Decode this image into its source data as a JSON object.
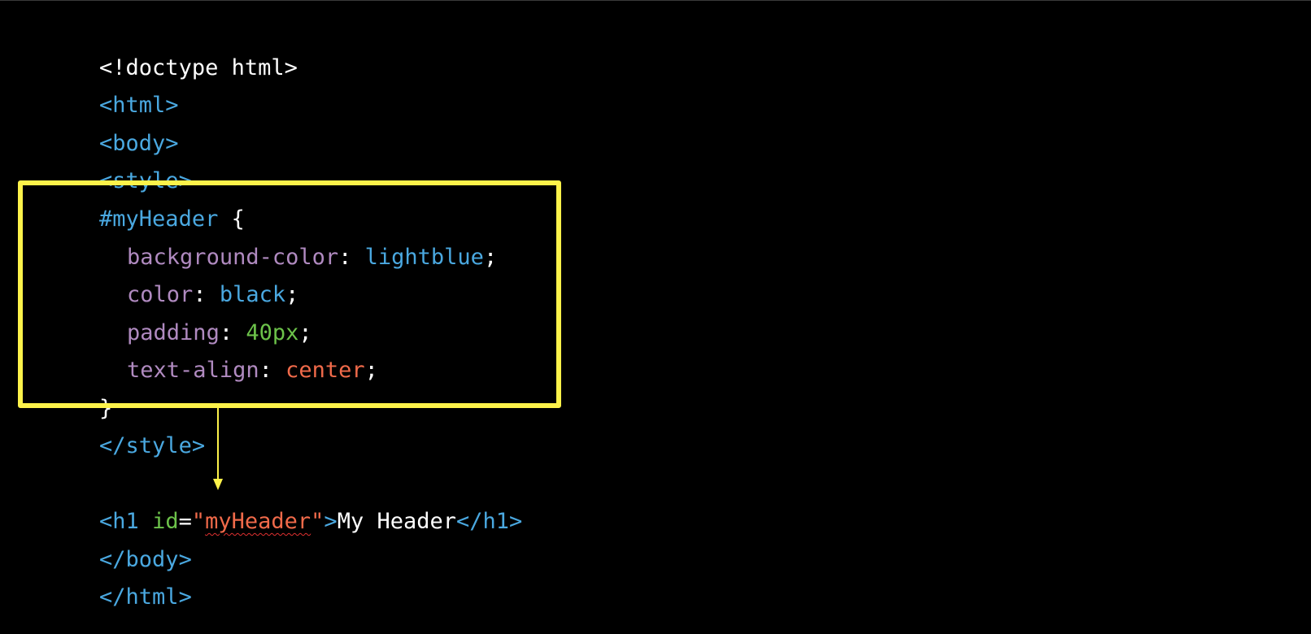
{
  "code": {
    "doctype": "<!doctype html>",
    "html_open": "<html>",
    "body_open": "<body>",
    "style_open": "<style>",
    "selector": "#myHeader",
    "brace_open": " {",
    "rules": [
      {
        "property": "background-color",
        "colon": ": ",
        "value": "lightblue",
        "semicolon": ";"
      },
      {
        "property": "color",
        "colon": ": ",
        "value": "black",
        "semicolon": ";"
      },
      {
        "property": "padding",
        "colon": ": ",
        "value": "40px",
        "semicolon": ";"
      },
      {
        "property": "text-align",
        "colon": ": ",
        "value": "center",
        "semicolon": ";"
      }
    ],
    "brace_close": "}",
    "style_close": "</style>",
    "h1_open_start": "<h1 ",
    "h1_attr_name": "id",
    "h1_equals": "=",
    "h1_quote_open": "\"",
    "h1_attr_value": "myHeader",
    "h1_quote_close": "\"",
    "h1_open_end": ">",
    "h1_text": "My Header",
    "h1_close": "</h1>",
    "body_close": "</body>",
    "html_close": "</html>"
  },
  "colors": {
    "background": "#000000",
    "tag": "#4aa8e0",
    "property": "#b08ac0",
    "number": "#6cc24a",
    "string": "#f06a4a",
    "highlight": "#fdf24a"
  }
}
